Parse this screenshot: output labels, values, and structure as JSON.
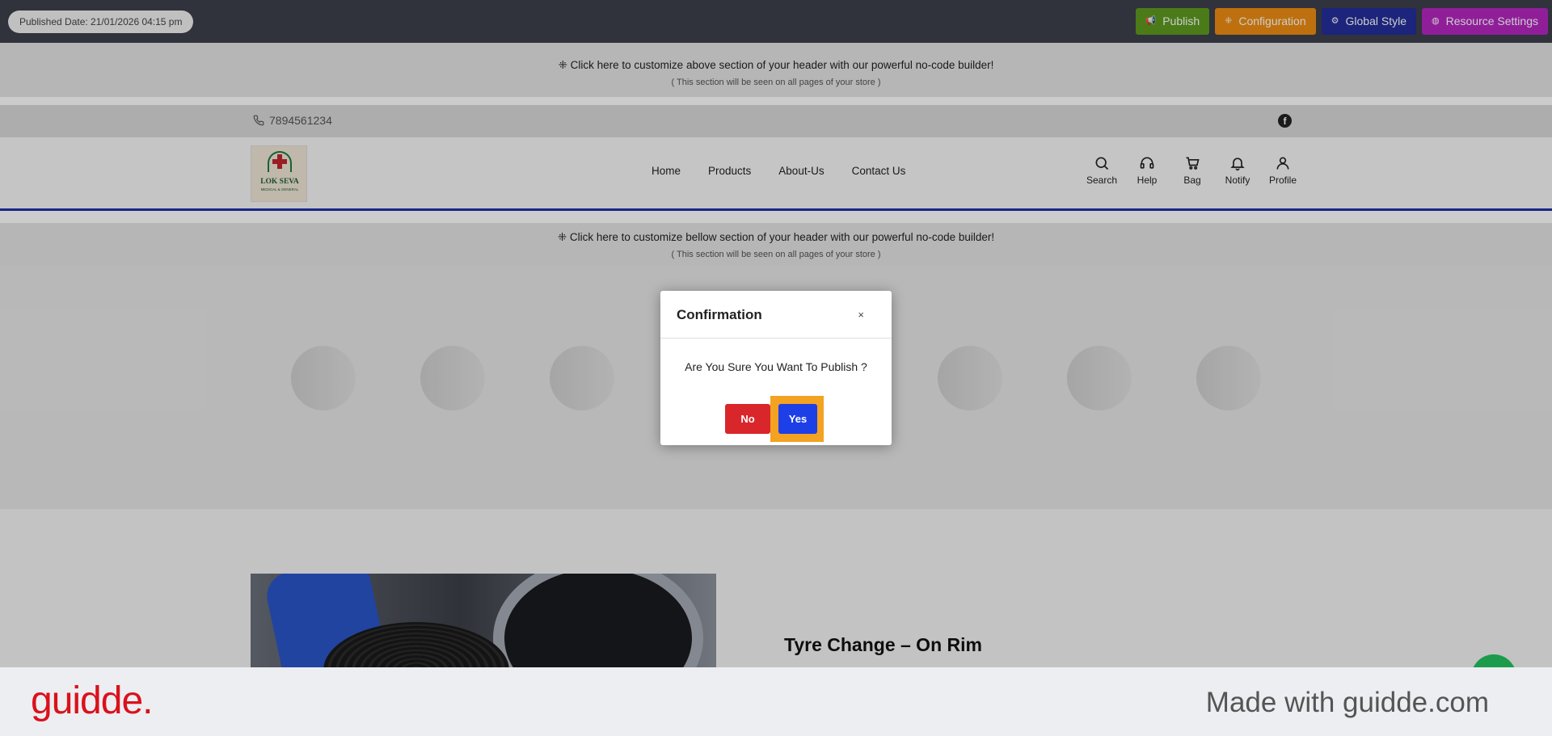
{
  "topbar": {
    "published_date": "Published Date: 21/01/2026 04:15 pm",
    "buttons": {
      "publish": "Publish",
      "configuration": "Configuration",
      "global_style": "Global Style",
      "resource_settings": "Resource Settings"
    }
  },
  "header_above": {
    "line1": "⁜ Click here to customize above section of your header with our powerful no-code builder!",
    "line2": "( This section will be seen on all pages of your store )"
  },
  "contact": {
    "phone": "7894561234"
  },
  "logo": {
    "name": "LOK SEVA",
    "subtitle": "MEDICAL & GENERAL"
  },
  "nav": {
    "home": "Home",
    "products": "Products",
    "about": "About-Us",
    "contact": "Contact Us"
  },
  "header_icons": {
    "search": "Search",
    "help": "Help",
    "bag": "Bag",
    "notify": "Notify",
    "profile": "Profile"
  },
  "header_below": {
    "line1": "⁜ Click here to customize bellow section of your header with our powerful no-code builder!",
    "line2": "( This section will be seen on all pages of your store )"
  },
  "service": {
    "title": "Tyre Change – On Rim"
  },
  "modal": {
    "title": "Confirmation",
    "close": "×",
    "message": "Are You Sure You Want To Publish ?",
    "no_label": "No",
    "yes_label": "Yes"
  },
  "footer": {
    "logo_text": "guidde.",
    "made_with": "Made with guidde.com"
  },
  "colors": {
    "publish": "#5e9a1f",
    "configuration": "#ee8d12",
    "global_style": "#242e9a",
    "resource_settings": "#b526c0",
    "no_button": "#d9262b",
    "yes_button": "#1d3fe8",
    "highlight": "#f3a221"
  }
}
